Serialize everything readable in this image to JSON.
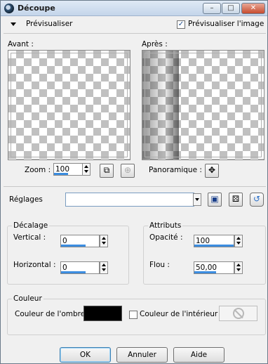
{
  "window": {
    "title": "Découpe"
  },
  "titlebar": {
    "min_glyph": "–",
    "max_glyph": "□",
    "close_glyph": "✕"
  },
  "preview": {
    "toggle_label": "Prévisualiser",
    "preview_image_label": "Prévisualiser l'image",
    "preview_image_checked": true,
    "before_label": "Avant :",
    "after_label": "Après :"
  },
  "zoom": {
    "label": "Zoom :",
    "value": "100",
    "progress": 0.5
  },
  "pan": {
    "label": "Panoramique :",
    "icon": "move-icon"
  },
  "settings": {
    "label": "Réglages",
    "value": "",
    "save_icon": "save-disk-icon",
    "random_icon": "dice-icon",
    "reset_icon": "reset-arrow-icon"
  },
  "offset_group": {
    "title": "Décalage",
    "vertical_label": "Vertical :",
    "vertical_value": "0",
    "horizontal_label": "Horizontal :",
    "horizontal_value": "0"
  },
  "attributes_group": {
    "title": "Attributs",
    "opacity_label": "Opacité :",
    "opacity_value": "100",
    "blur_label": "Flou :",
    "blur_value": "50,00"
  },
  "color_group": {
    "title": "Couleur",
    "shadow_color_label": "Couleur de l'ombre :",
    "shadow_color": "#000000",
    "interior_color_label": "Couleur de l'intérieur :",
    "interior_checked": false
  },
  "buttons": {
    "ok": "OK",
    "cancel": "Annuler",
    "help": "Aide"
  },
  "colors": {
    "accent": "#3c8de0",
    "window_bg": "#f0f0f0"
  }
}
